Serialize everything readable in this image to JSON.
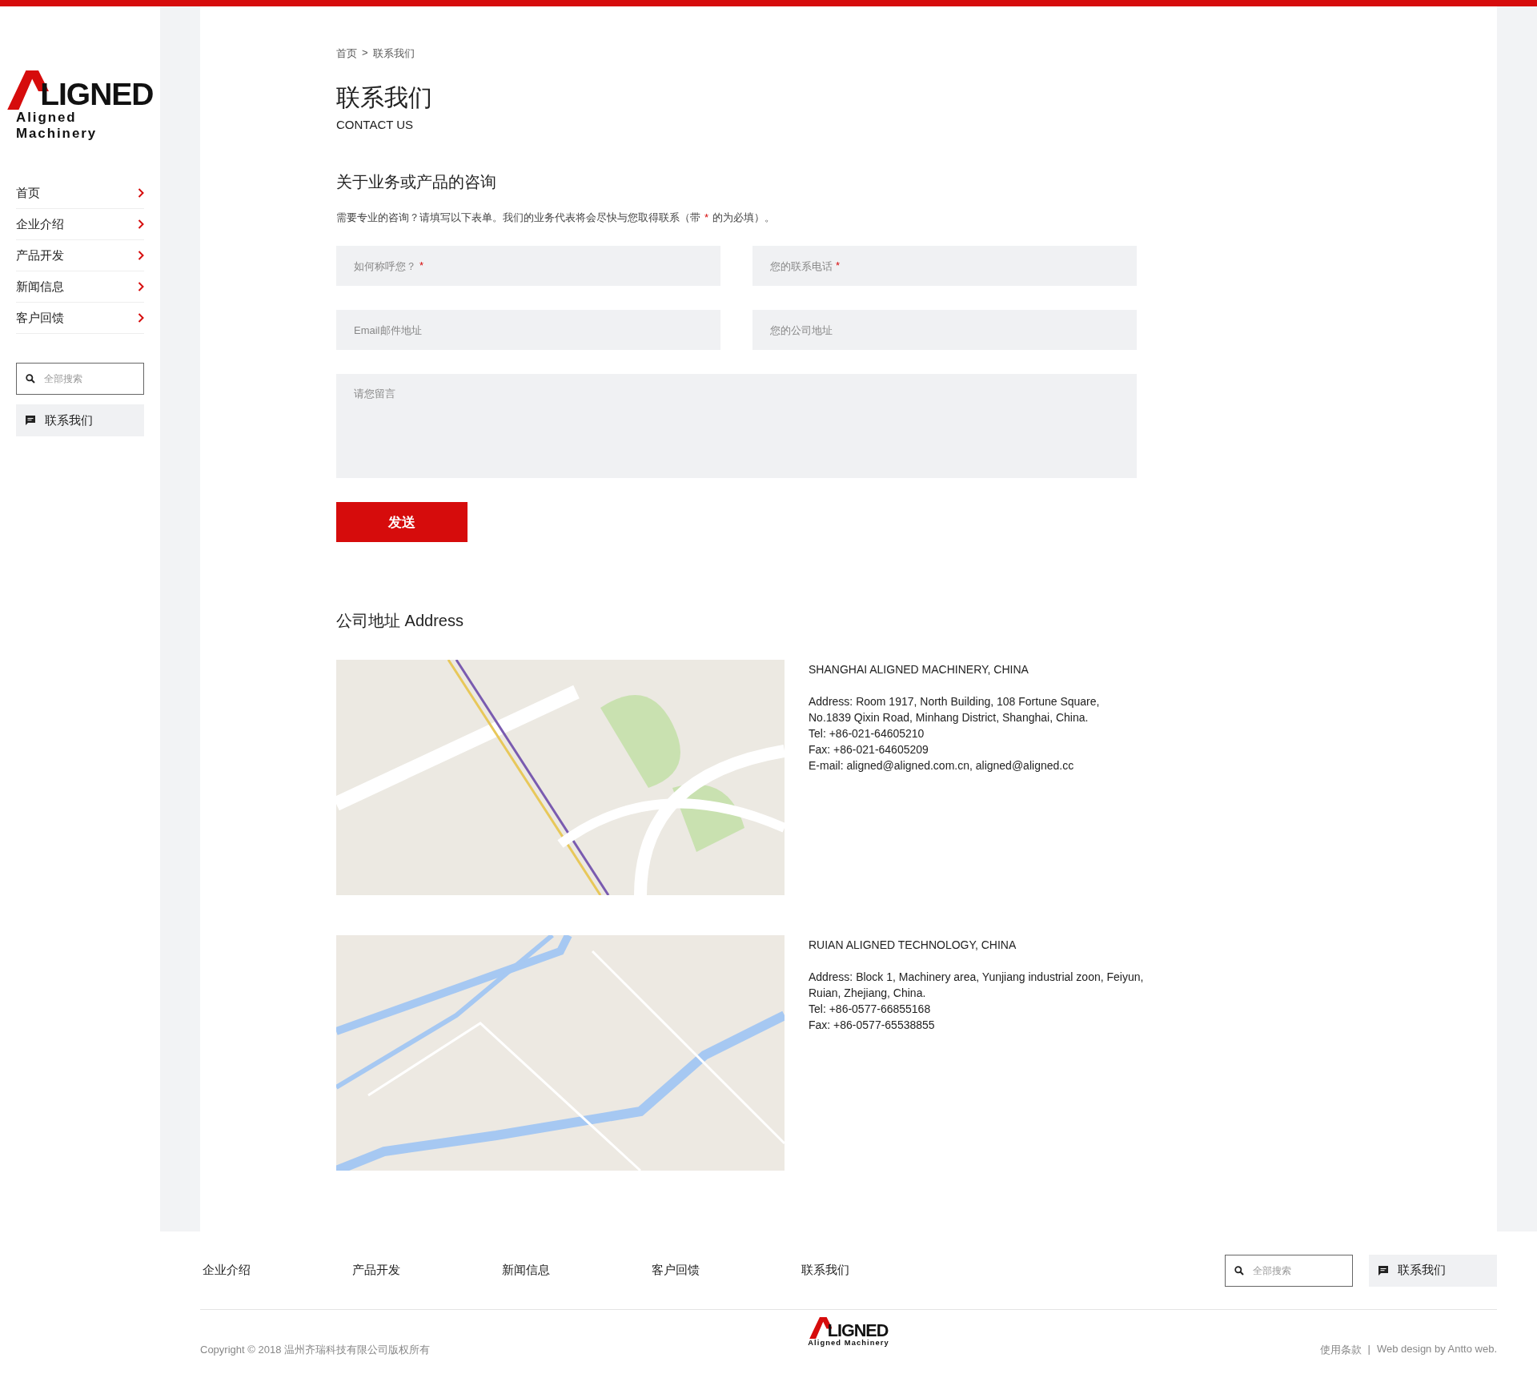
{
  "logo": {
    "word": "LIGNED",
    "tagline": "Aligned Machinery"
  },
  "sidebar": {
    "items": [
      {
        "label": "首页"
      },
      {
        "label": "企业介绍"
      },
      {
        "label": "产品开发"
      },
      {
        "label": "新闻信息"
      },
      {
        "label": "客户回馈"
      }
    ],
    "search": {
      "placeholder": "全部搜索"
    },
    "contact_button": "联系我们"
  },
  "breadcrumb": {
    "items": [
      "首页",
      "联系我们"
    ],
    "separator": ">"
  },
  "title": "联系我们",
  "subtitle": "CONTACT US",
  "form": {
    "heading": "关于业务或产品的咨询",
    "description": {
      "before": "需要专业的咨询？请填写以下表单。我们的业务代表将会尽快与您取得联系（带",
      "mark": "*",
      "after": "的为必填）。"
    },
    "fields": [
      {
        "placeholder": "如何称呼您？",
        "required": true
      },
      {
        "placeholder": "您的联系电话",
        "required": true
      },
      {
        "placeholder": "Email邮件地址",
        "required": false
      },
      {
        "placeholder": "您的公司地址",
        "required": false
      }
    ],
    "message": {
      "placeholder": "请您留言"
    },
    "submit": "发送"
  },
  "address": {
    "heading": "公司地址 Address",
    "offices": [
      {
        "kind": "city",
        "name": "SHANGHAI ALIGNED MACHINERY, CHINA",
        "lines": [
          "Address: Room 1917, North Building, 108 Fortune Square,",
          "No.1839 Qixin Road, Minhang District, Shanghai, China.",
          "Tel: +86-021-64605210",
          "Fax: +86-021-64605209",
          "E-mail: aligned@aligned.com.cn, aligned@aligned.cc"
        ]
      },
      {
        "kind": "river",
        "name": "RUIAN ALIGNED TECHNOLOGY, CHINA",
        "lines": [
          "Address: Block 1, Machinery area, Yunjiang industrial zoon, Feiyun,",
          "Ruian, Zhejiang, China.",
          "Tel: +86-0577-66855168",
          "Fax: +86-0577-65538855"
        ]
      }
    ]
  },
  "footer": {
    "nav": [
      "企业介绍",
      "产品开发",
      "新闻信息",
      "客户回馈",
      "联系我们"
    ],
    "search": {
      "placeholder": "全部搜索"
    },
    "contact_button": "联系我们",
    "logo": {
      "word": "LIGNED",
      "tagline": "Aligned Machinery"
    },
    "copyright": "Copyright © 2018 温州齐瑞科技有限公司版权所有",
    "links": [
      "使用条款",
      "Web design by Antto web."
    ],
    "link_separator": "|"
  }
}
